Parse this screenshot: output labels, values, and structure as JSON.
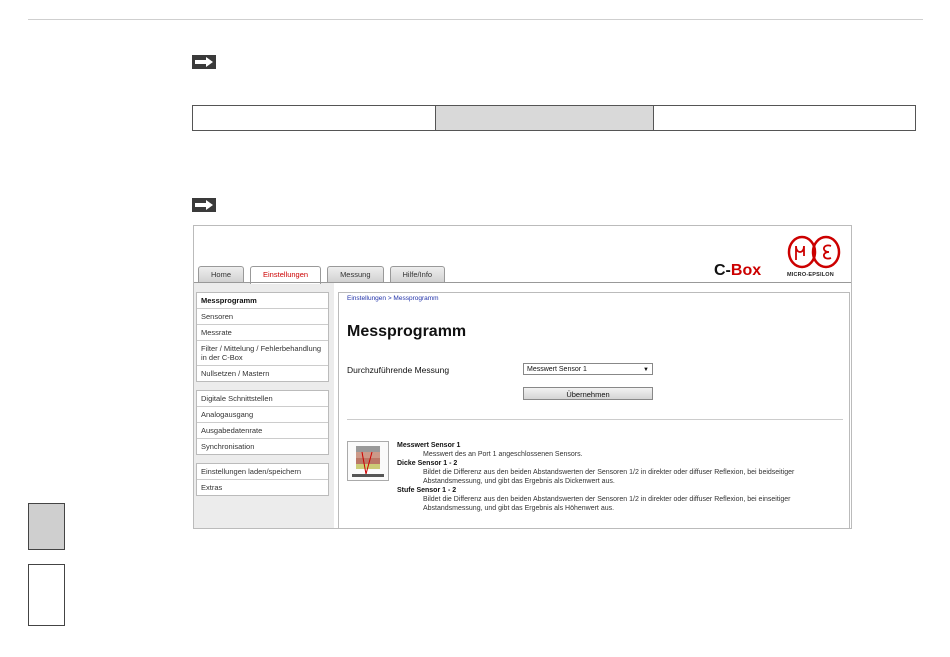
{
  "app": {
    "tabs": [
      {
        "label": "Home"
      },
      {
        "label": "Einstellungen"
      },
      {
        "label": "Messung"
      },
      {
        "label": "Hilfe/Info"
      }
    ],
    "brand": {
      "prefix": "C-",
      "name": "Box"
    },
    "logo_text": "MICRO-EPSILON"
  },
  "nav": {
    "group1": [
      "Messprogramm",
      "Sensoren",
      "Messrate",
      "Filter / Mittelung / Fehlerbehandlung in der C-Box",
      "Nullsetzen / Mastern"
    ],
    "group2": [
      "Digitale Schnittstellen",
      "Analogausgang",
      "Ausgabedatenrate",
      "Synchronisation"
    ],
    "group3": [
      "Einstellungen laden/speichern",
      "Extras"
    ]
  },
  "content": {
    "breadcrumb": "Einstellungen > Messprogramm",
    "title": "Messprogramm",
    "field_label": "Durchzuführende Messung",
    "select_value": "Messwert Sensor 1",
    "button": "Übernehmen",
    "descriptions": [
      {
        "heading": "Messwert Sensor 1",
        "text": "Messwert des an Port 1 angeschlossenen Sensors."
      },
      {
        "heading": "Dicke Sensor 1 - 2",
        "text": "Bildet die Differenz aus den beiden Abstandswerten der Sensoren 1/2 in direkter oder diffuser Reflexion, bei beidseitiger Abstandsmessung, und gibt das Ergebnis als Dickenwert aus."
      },
      {
        "heading": "Stufe Sensor 1 - 2",
        "text": "Bildet die Differenz aus den beiden Abstandswerten der Sensoren 1/2 in direkter oder diffuser Reflexion, bei einseitiger Abstandsmessung, und gibt das Ergebnis als Höhenwert aus."
      }
    ]
  },
  "colors": {
    "accent": "#cc0000",
    "link": "#2233aa",
    "tab_bg": "#d9d9d9"
  },
  "icons": [
    "arrow-right-icon",
    "arrow-right-icon",
    "micro-epsilon-logo-icon",
    "dropdown-caret-icon",
    "sensor-thumbnail-icon"
  ]
}
